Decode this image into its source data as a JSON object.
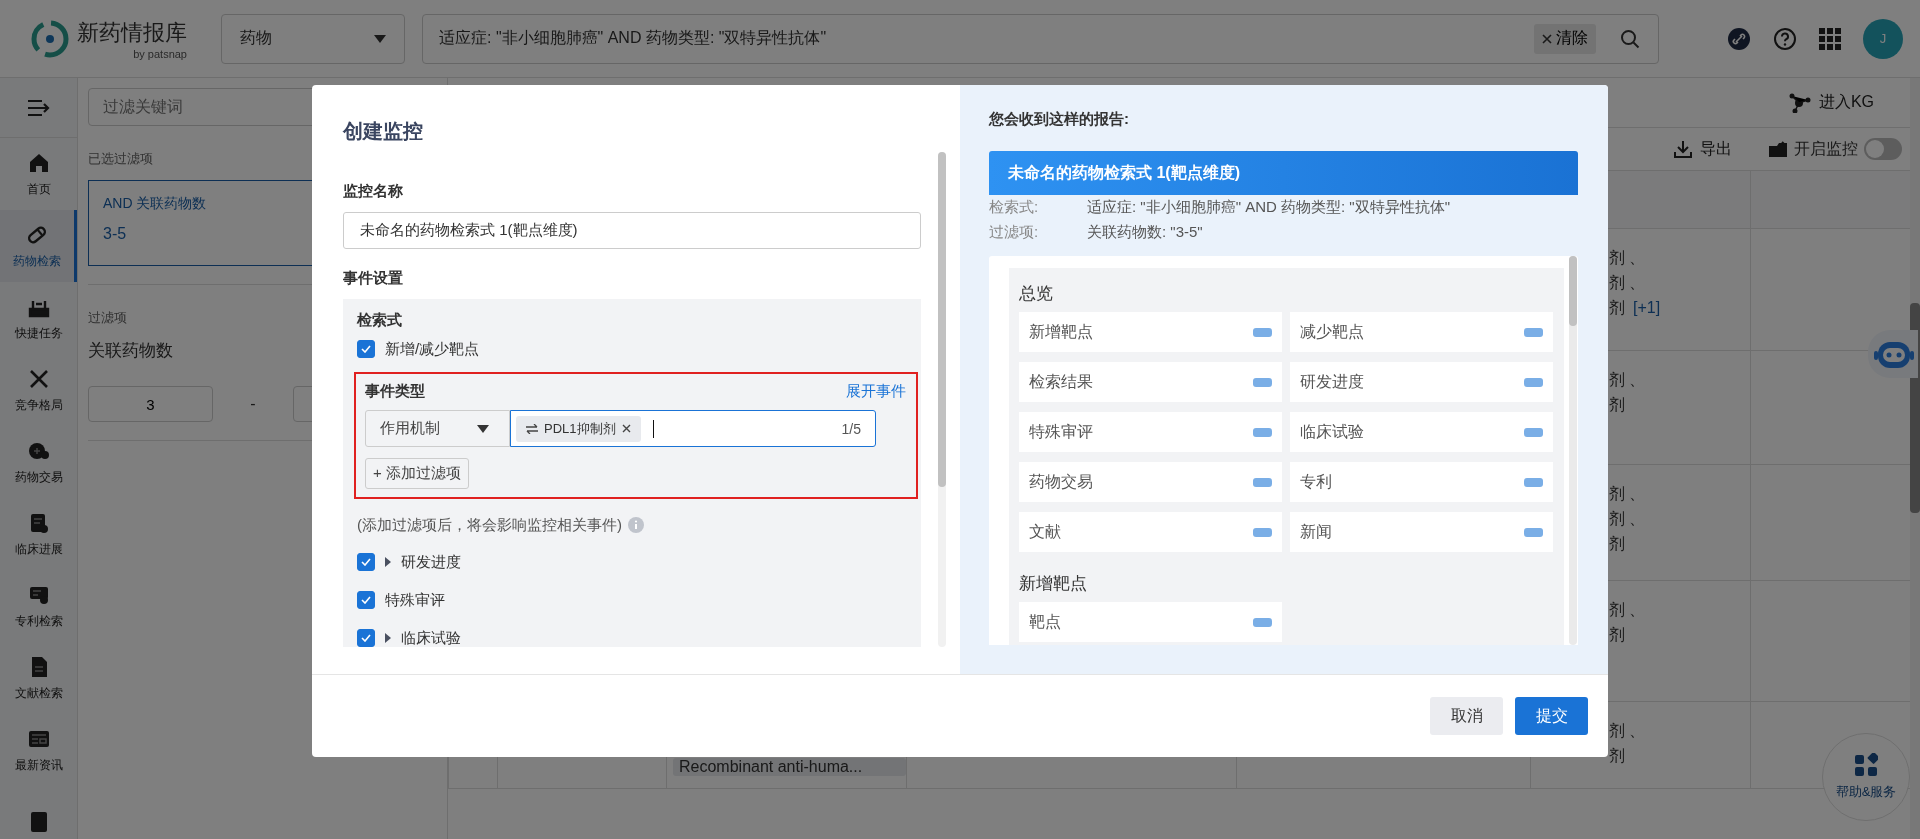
{
  "topbar": {
    "logo_name": "新药情报库",
    "logo_byline": "by patsnap",
    "category_select": {
      "value": "药物"
    },
    "search": {
      "value": "适应症: \"非小细胞肺癌\" AND 药物类型: \"双特异性抗体\"",
      "clear_label": "清除"
    },
    "avatar": {
      "initial": "J"
    }
  },
  "nav": {
    "items": [
      {
        "label": "首页",
        "selected": false
      },
      {
        "label": "药物检索",
        "selected": true
      },
      {
        "label": "快捷任务",
        "selected": false
      },
      {
        "label": "竞争格局",
        "selected": false
      },
      {
        "label": "药物交易",
        "selected": false
      },
      {
        "label": "临床进展",
        "selected": false
      },
      {
        "label": "专利检索",
        "selected": false
      },
      {
        "label": "文献检索",
        "selected": false
      },
      {
        "label": "最新资讯",
        "selected": false
      },
      {
        "selected": false
      }
    ]
  },
  "filter_panel": {
    "keyword_placeholder": "过滤关键词",
    "selected_heading": "已选过滤项",
    "selected_card": {
      "title": "AND 关联药物数",
      "value": "3-5"
    },
    "filters_heading": "过滤项",
    "filter_name": "关联药物数",
    "range_min": "3",
    "range_separator": "-"
  },
  "toolbar": {
    "kg_label": "进入KG",
    "export_label": "导出",
    "monitor": {
      "label": "开启监控",
      "on": false
    }
  },
  "table": {
    "rows": [
      {
        "column_6": [
          "剂 、",
          "剂 、",
          "剂"
        ],
        "more": "[+1]"
      },
      {
        "column_6": [
          "剂 、",
          "剂"
        ]
      },
      {
        "column_6": [
          "剂 、",
          "剂 、",
          "剂"
        ]
      },
      {
        "column_6": [
          "剂 、",
          "剂"
        ]
      },
      {
        "column_3": "Recombinant anti-huma...",
        "column_6": [
          "剂 、",
          "剂"
        ]
      }
    ]
  },
  "help_button": {
    "label": "帮助&服务"
  },
  "modal": {
    "title": "创建监控",
    "name_label": "监控名称",
    "name_value": "未命名的药物检索式 1(靶点维度)",
    "events_heading": "事件设置",
    "query_heading": "检索式",
    "query_events": [
      {
        "label": "新增/减少靶点",
        "checked": true
      }
    ],
    "event_type": {
      "heading": "事件类型",
      "expand_link": "展开事件",
      "filter_select": "作用机制",
      "tags": [
        {
          "label": "PDL1抑制剂"
        }
      ],
      "count": "1/5",
      "add_button": "+ 添加过滤项"
    },
    "hint": "(添加过滤项后，将会影响监控相关事件)",
    "events": [
      {
        "label": "研发进度",
        "checked": true,
        "kind": "group"
      },
      {
        "label": "特殊审评",
        "checked": true,
        "kind": "event"
      },
      {
        "label": "临床试验",
        "checked": true,
        "kind": "group"
      }
    ],
    "report": {
      "heading": "您会收到这样的报告:",
      "title": "未命名的药物检索式 1(靶点维度)",
      "meta": [
        {
          "label": "检索式:",
          "value": "适应症: \"非小细胞肺癌\" AND 药物类型: \"双特异性抗体\""
        },
        {
          "label": "过滤项:",
          "value": "关联药物数: \"3-5\""
        }
      ],
      "sections": [
        {
          "title": "总览",
          "items": [
            "新增靶点",
            "减少靶点",
            "检索结果",
            "研发进度",
            "特殊审评",
            "临床试验",
            "药物交易",
            "专利",
            "文献",
            "新闻"
          ]
        },
        {
          "title": "新增靶点",
          "items": [
            "靶点"
          ]
        }
      ]
    },
    "buttons": [
      {
        "label": "取消",
        "kind": "secondary"
      },
      {
        "label": "提交",
        "kind": "primary"
      }
    ]
  }
}
